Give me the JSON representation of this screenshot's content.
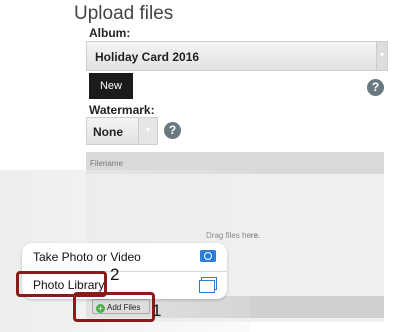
{
  "page": {
    "title": "Upload files"
  },
  "album": {
    "label": "Album:",
    "value": "Holiday Card 2016"
  },
  "new_button": {
    "label": "New"
  },
  "watermark": {
    "label": "Watermark:",
    "value": "None"
  },
  "help": {
    "glyph": "?"
  },
  "upload": {
    "column_header": "Filename",
    "drop_hint": "Drag files here.",
    "add_files_label": "Add Files"
  },
  "popup": {
    "items": [
      {
        "label": "Take Photo or Video",
        "icon": "camera-icon"
      },
      {
        "label": "Photo Library",
        "icon": "photo-library-icon"
      }
    ]
  },
  "annotations": {
    "step1": "1",
    "step2": "2"
  },
  "colors": {
    "accent": "#2a7ed4",
    "highlight": "#8b1a1a",
    "add_green": "#4cae4c"
  }
}
